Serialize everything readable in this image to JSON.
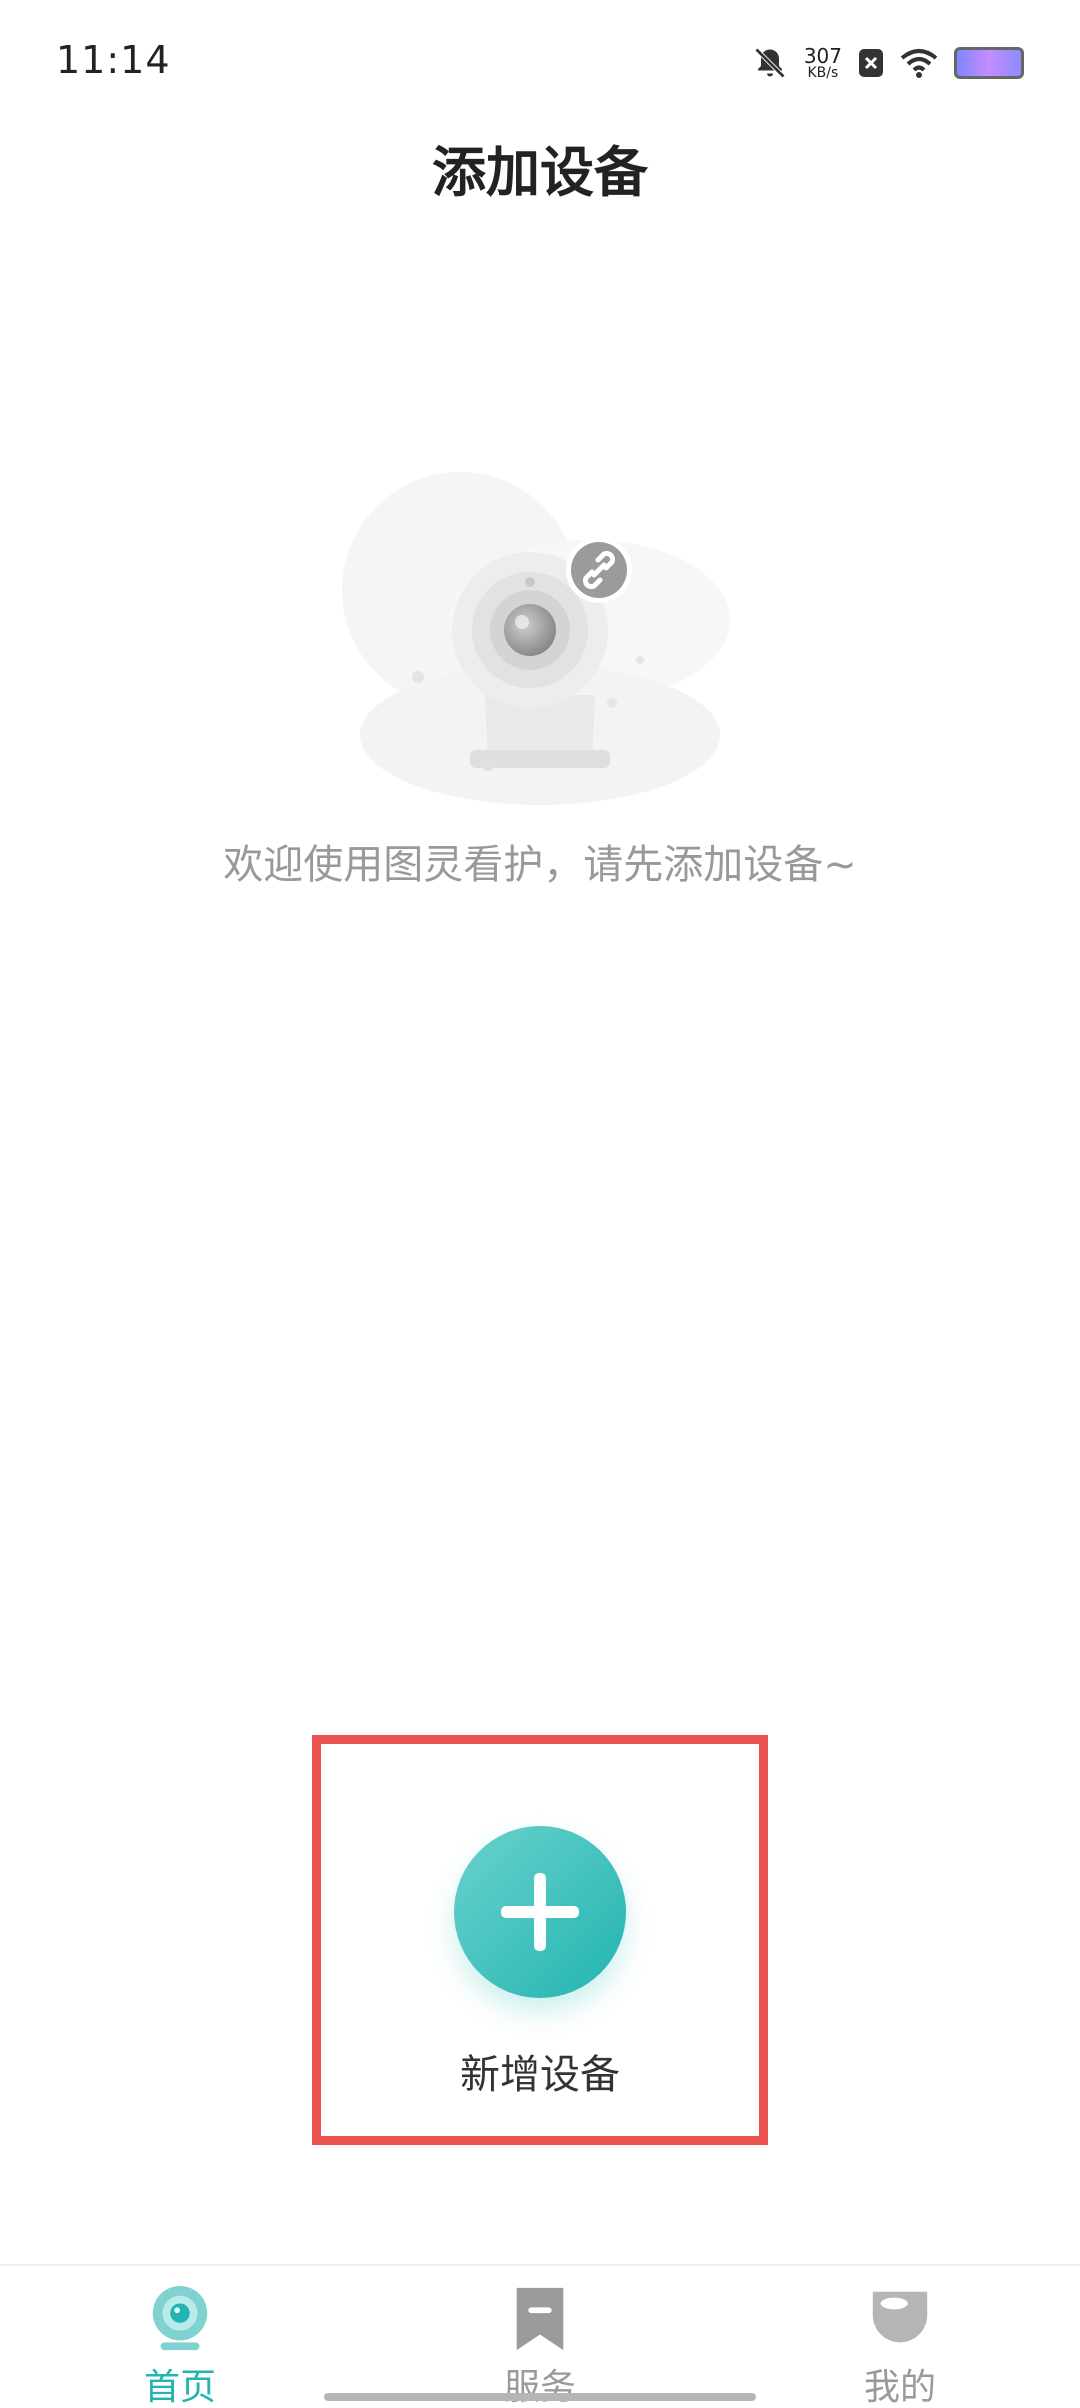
{
  "status_bar": {
    "time": "11:14",
    "net_speed_value": "307",
    "net_speed_unit": "KB/s",
    "icons": [
      "bell-off-icon",
      "network-speed",
      "close-box-icon",
      "wifi-icon",
      "battery-icon"
    ]
  },
  "header": {
    "title": "添加设备"
  },
  "empty_state": {
    "illustration": "camera-link-illustration",
    "message": "欢迎使用图灵看护，请先添加设备~"
  },
  "add_device": {
    "icon": "plus-icon",
    "label": "新增设备"
  },
  "tabs": [
    {
      "label": "首页",
      "icon": "camera-tab-icon",
      "active": true
    },
    {
      "label": "服务",
      "icon": "bookmark-tab-icon",
      "active": false
    },
    {
      "label": "我的",
      "icon": "profile-tab-icon",
      "active": false
    }
  ],
  "colors": {
    "accent": "#22b4b0",
    "highlight_border": "#e8524f",
    "title_text": "#222222",
    "muted_text": "#999999"
  }
}
